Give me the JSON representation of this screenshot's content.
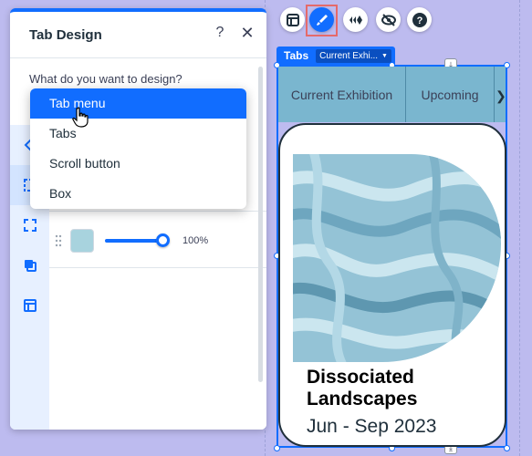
{
  "panel": {
    "title": "Tab Design",
    "help_icon": "?",
    "close_icon": "✕",
    "question": "What do you want to design?",
    "opacity_value": "100%",
    "swatch_color": "#a8d3de"
  },
  "dropdown": {
    "items": [
      {
        "label": "Tab menu"
      },
      {
        "label": "Tabs"
      },
      {
        "label": "Scroll button"
      },
      {
        "label": "Box"
      }
    ],
    "selected": "Tab menu"
  },
  "toolbar": {
    "buttons": [
      {
        "icon": "layout-icon"
      },
      {
        "icon": "design-brush-icon"
      },
      {
        "icon": "animation-icon"
      },
      {
        "icon": "hide-icon"
      },
      {
        "icon": "help-icon"
      }
    ]
  },
  "widget": {
    "tag_label": "Tabs",
    "tag_select": "Current Exhi...",
    "tabs": [
      "Current Exhibition",
      "Upcoming"
    ],
    "card_title_line1": "Dissociated",
    "card_title_line2": "Landscapes",
    "card_date": "Jun - Sep 2023"
  },
  "colors": {
    "accent": "#116dff",
    "canvas": "#bdbbef",
    "tab_bg": "#7ab6cf"
  }
}
